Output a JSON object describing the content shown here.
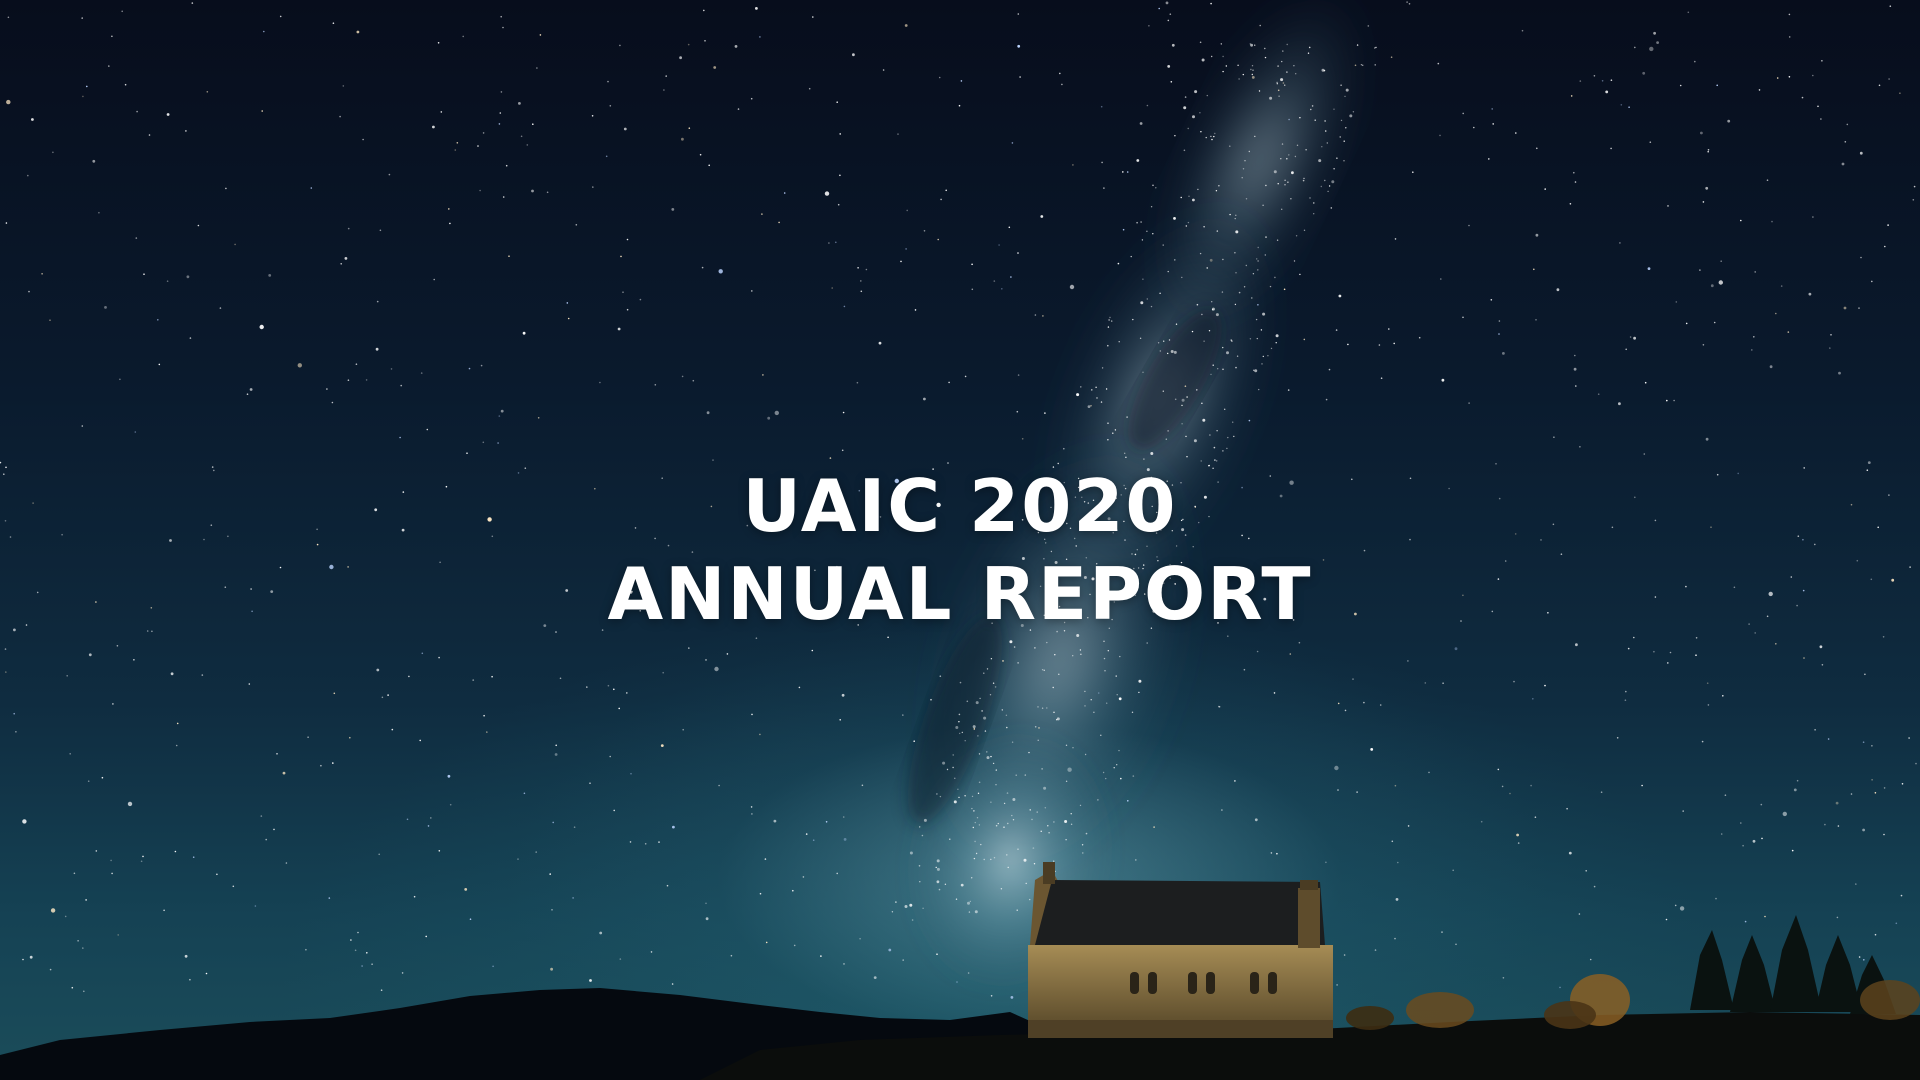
{
  "title": {
    "line1": "UAIC 2020",
    "line2": "ANNUAL REPORT"
  },
  "background": {
    "scene": "night sky with milky way over stone church",
    "sky_color_top": "#070d1c",
    "sky_color_bottom": "#1b4d5a",
    "glow_color": "#78afbe",
    "title_color": "#ffffff"
  }
}
